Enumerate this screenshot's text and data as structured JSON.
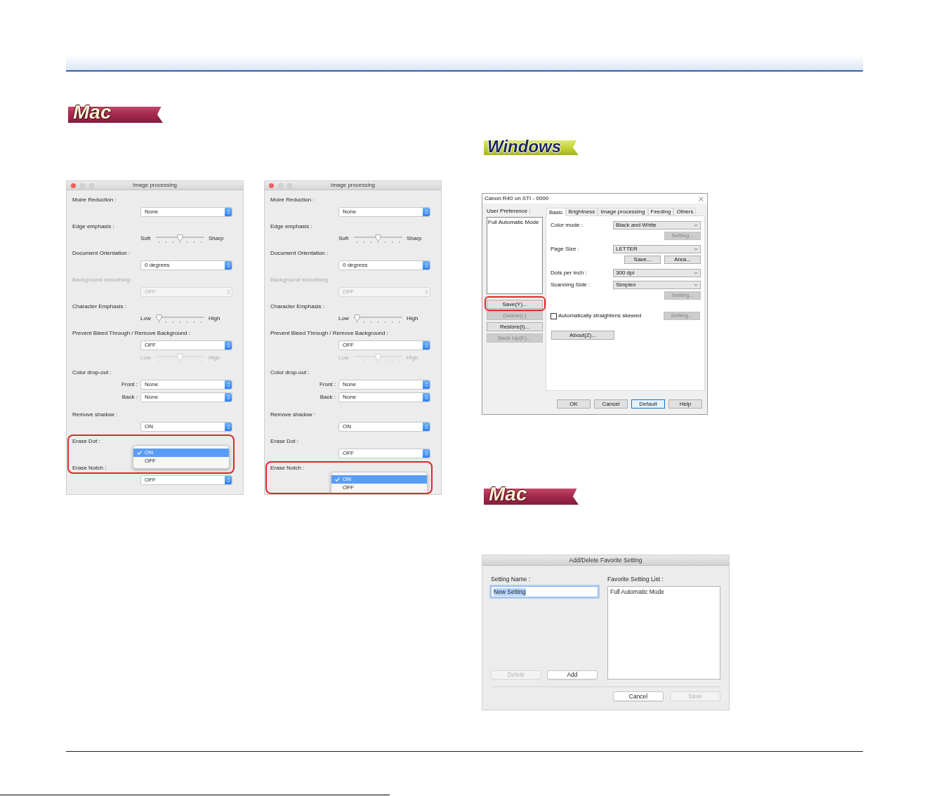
{
  "image_processing": {
    "badge": {
      "kind": "mac",
      "label": "Mac"
    },
    "dialogs": [
      {
        "title": "Image processing",
        "rows": [
          {
            "label": "Moire Reduction :",
            "disabled": false,
            "highlight": false,
            "controls": [
              {
                "kind": "select",
                "value": "None",
                "disabled": false
              }
            ]
          },
          {
            "label": "Edge emphasis :",
            "disabled": false,
            "highlight": false,
            "controls": [
              {
                "kind": "slider",
                "low": "Soft",
                "high": "Sharp",
                "level": 0.5,
                "disabled": false
              }
            ]
          },
          {
            "label": "Document Orientation :",
            "disabled": false,
            "highlight": false,
            "controls": [
              {
                "kind": "select",
                "value": "0 degrees",
                "disabled": false
              }
            ]
          },
          {
            "label": "Background smoothing :",
            "disabled": true,
            "highlight": false,
            "controls": [
              {
                "kind": "select",
                "value": "OFF",
                "disabled": true
              }
            ]
          },
          {
            "label": "Character Emphasis :",
            "disabled": false,
            "highlight": false,
            "controls": [
              {
                "kind": "slider",
                "low": "Low",
                "high": "High",
                "level": 0,
                "disabled": false
              }
            ]
          },
          {
            "label": "Prevent Bleed Through / Remove Background :",
            "disabled": false,
            "highlight": false,
            "controls": [
              {
                "kind": "select",
                "value": "OFF",
                "disabled": false
              },
              {
                "kind": "slider",
                "low": "Low",
                "high": "High",
                "level": 0.5,
                "disabled": true
              }
            ]
          },
          {
            "label": "Color drop-out :",
            "disabled": false,
            "highlight": false,
            "controls": [
              {
                "kind": "select",
                "field": "Front :",
                "value": "None",
                "disabled": false
              },
              {
                "kind": "select",
                "field": "Back :",
                "value": "None",
                "disabled": false
              }
            ]
          },
          {
            "label": "Remove shadow :",
            "disabled": false,
            "highlight": false,
            "controls": [
              {
                "kind": "select",
                "value": "ON",
                "disabled": false
              }
            ]
          },
          {
            "label": "Erase Dot :",
            "disabled": false,
            "highlight": true,
            "controls": [
              {
                "kind": "open_select",
                "options": [
                  {
                    "label": "ON",
                    "selected": true
                  },
                  {
                    "label": "OFF",
                    "selected": false
                  }
                ]
              }
            ]
          },
          {
            "label": "Erase Notch :",
            "disabled": false,
            "highlight": false,
            "controls": [
              {
                "kind": "select",
                "value": "OFF",
                "disabled": false
              }
            ]
          }
        ]
      },
      {
        "title": "Image processing",
        "rows": [
          {
            "label": "Moire Reduction :",
            "disabled": false,
            "highlight": false,
            "controls": [
              {
                "kind": "select",
                "value": "None",
                "disabled": false
              }
            ]
          },
          {
            "label": "Edge emphasis :",
            "disabled": false,
            "highlight": false,
            "controls": [
              {
                "kind": "slider",
                "low": "Soft",
                "high": "Sharp",
                "level": 0.5,
                "disabled": false
              }
            ]
          },
          {
            "label": "Document Orientation :",
            "disabled": false,
            "highlight": false,
            "controls": [
              {
                "kind": "select",
                "value": "0 degrees",
                "disabled": false
              }
            ]
          },
          {
            "label": "Background smoothing :",
            "disabled": true,
            "highlight": false,
            "controls": [
              {
                "kind": "select",
                "value": "OFF",
                "disabled": true
              }
            ]
          },
          {
            "label": "Character Emphasis :",
            "disabled": false,
            "highlight": false,
            "controls": [
              {
                "kind": "slider",
                "low": "Low",
                "high": "High",
                "level": 0,
                "disabled": false
              }
            ]
          },
          {
            "label": "Prevent Bleed Through / Remove Background :",
            "disabled": false,
            "highlight": false,
            "controls": [
              {
                "kind": "select",
                "value": "OFF",
                "disabled": false
              },
              {
                "kind": "slider",
                "low": "Low",
                "high": "High",
                "level": 0.5,
                "disabled": true
              }
            ]
          },
          {
            "label": "Color drop-out :",
            "disabled": false,
            "highlight": false,
            "controls": [
              {
                "kind": "select",
                "field": "Front :",
                "value": "None",
                "disabled": false
              },
              {
                "kind": "select",
                "field": "Back :",
                "value": "None",
                "disabled": false
              }
            ]
          },
          {
            "label": "Remove shadow :",
            "disabled": false,
            "highlight": false,
            "controls": [
              {
                "kind": "select",
                "value": "ON",
                "disabled": false
              }
            ]
          },
          {
            "label": "Erase Dot :",
            "disabled": false,
            "highlight": false,
            "controls": [
              {
                "kind": "select",
                "value": "OFF",
                "disabled": false
              }
            ]
          },
          {
            "label": "Erase Notch :",
            "disabled": false,
            "highlight": true,
            "controls": [
              {
                "kind": "open_select",
                "options": [
                  {
                    "label": "ON",
                    "selected": true
                  },
                  {
                    "label": "OFF",
                    "selected": false
                  }
                ]
              }
            ]
          }
        ]
      }
    ]
  },
  "windows_settings": {
    "badge": {
      "kind": "windows",
      "label": "Windows"
    },
    "window": {
      "title": "Canon R40 on STI - 0000",
      "preference_label": "User Preference :",
      "preferences": [
        {
          "label": "Full Automatic Mode",
          "selected": false
        }
      ],
      "preference_buttons": [
        {
          "label": "Save(Y)...",
          "disabled": false,
          "highlight": true
        },
        {
          "label": "Delete(L)",
          "disabled": true,
          "highlight": false
        },
        {
          "label": "Restore(I)...",
          "disabled": false,
          "highlight": false
        },
        {
          "label": "Back Up(K)...",
          "disabled": true,
          "highlight": false
        }
      ],
      "tabs": [
        {
          "label": "Basic",
          "selected": true
        },
        {
          "label": "Brightness",
          "selected": false
        },
        {
          "label": "Image processing",
          "selected": false
        },
        {
          "label": "Feeding",
          "selected": false
        },
        {
          "label": "Others",
          "selected": false
        }
      ],
      "fields": [
        {
          "kind": "combo",
          "label": "Color mode :",
          "value": "Black and White",
          "buttons": [
            {
              "label": "Setting...",
              "disabled": true
            }
          ]
        },
        {
          "kind": "combo",
          "label": "Page Size :",
          "value": "LETTER",
          "buttons": [
            {
              "label": "Save...",
              "disabled": false
            },
            {
              "label": "Area...",
              "disabled": false
            }
          ]
        },
        {
          "kind": "combo",
          "label": "Dots per inch :",
          "value": "300 dpi"
        },
        {
          "kind": "combo",
          "label": "Scanning Side :",
          "value": "Simplex",
          "buttons": [
            {
              "label": "Setting...",
              "disabled": true
            }
          ]
        },
        {
          "kind": "checkbox",
          "label": "Automatically straightens skewed",
          "checked": false,
          "buttons": [
            {
              "label": "Setting...",
              "disabled": true
            }
          ]
        },
        {
          "kind": "button",
          "label": "About(Z)...",
          "disabled": false
        }
      ],
      "footer_buttons": [
        {
          "label": "OK",
          "focused": false
        },
        {
          "label": "Cancel",
          "focused": false
        },
        {
          "label": "Default",
          "focused": true
        },
        {
          "label": "Help",
          "focused": false
        }
      ]
    }
  },
  "favorites": {
    "badge": {
      "kind": "mac",
      "label": "Mac"
    },
    "dialog": {
      "title": "Add/Delete Favorite Setting",
      "name_label": "Setting Name :",
      "name": {
        "value": "New Setting",
        "text_selected": true
      },
      "list_label": "Favorite Setting List :",
      "list_items": [
        {
          "label": "Full Automatic Mode",
          "selected": false
        }
      ],
      "list_buttons": [
        {
          "label": "Delete",
          "disabled": true
        },
        {
          "label": "Add",
          "disabled": false
        }
      ],
      "footer_buttons": [
        {
          "label": "Cancel",
          "disabled": false
        },
        {
          "label": "Save",
          "disabled": true
        }
      ]
    }
  }
}
